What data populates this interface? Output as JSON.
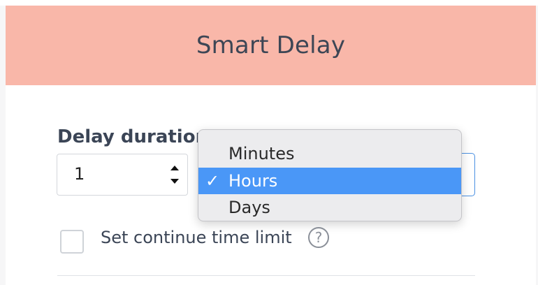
{
  "header": {
    "title": "Smart Delay"
  },
  "delay": {
    "label": "Delay duration",
    "value": "1"
  },
  "unit_select": {
    "options": [
      "Minutes",
      "Hours",
      "Days"
    ],
    "selected": "Hours",
    "check_mark": "✓"
  },
  "continue_limit": {
    "label": "Set continue time limit",
    "help_symbol": "?"
  },
  "colors": {
    "header_bg": "#f9b7a9",
    "selected_option_bg": "#4a97f7",
    "focus_border": "#4a90e2"
  }
}
